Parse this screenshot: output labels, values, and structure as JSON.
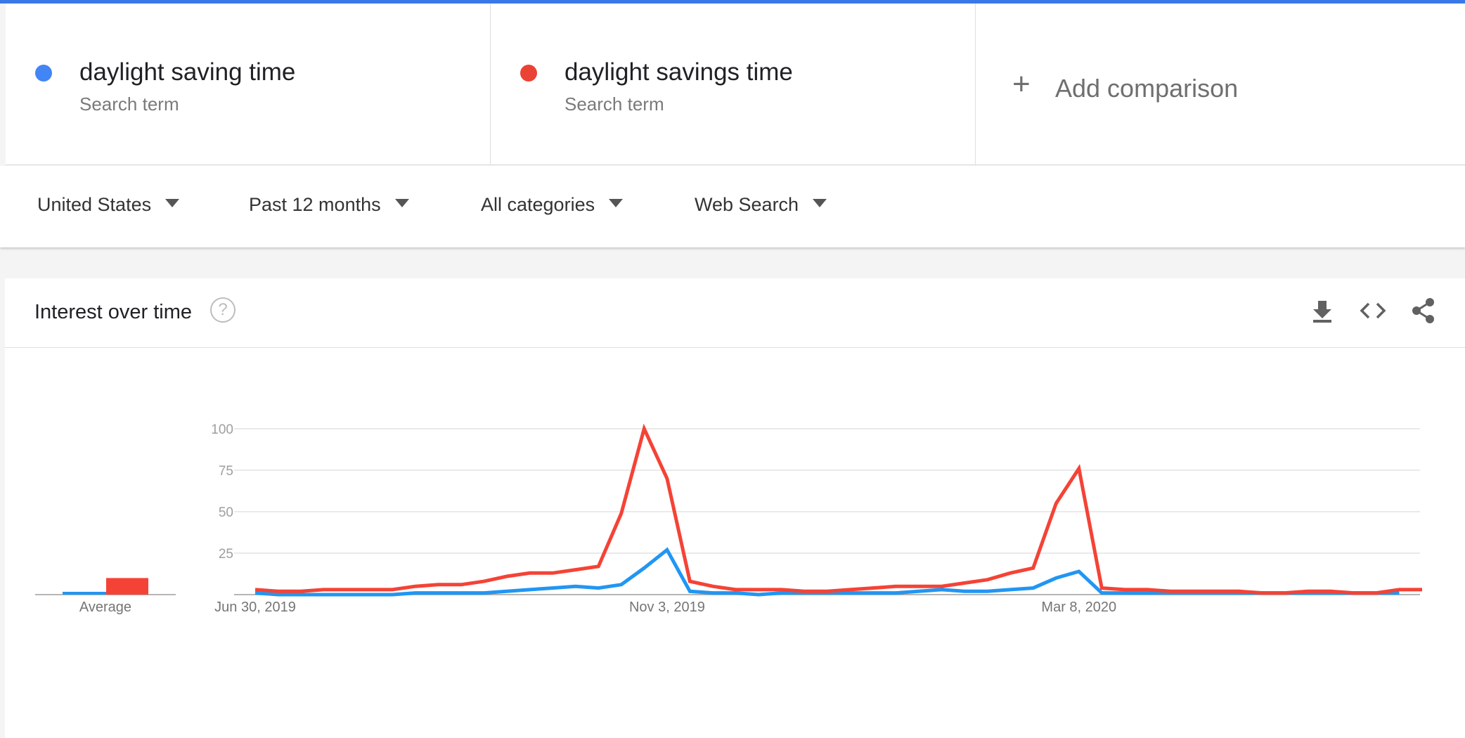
{
  "colors": {
    "top_bar": "#3b78e7",
    "term1": "#4285f4",
    "term2": "#ea4335",
    "line1": "#2196f3",
    "line2": "#f44336"
  },
  "terms": [
    {
      "name": "daylight saving time",
      "type": "Search term",
      "color": "#4285f4"
    },
    {
      "name": "daylight savings time",
      "type": "Search term",
      "color": "#ea4335"
    }
  ],
  "add_comparison": {
    "label": "Add comparison",
    "icon": "plus-icon"
  },
  "filters": [
    {
      "label": "United States",
      "icon": "dropdown-caret-icon"
    },
    {
      "label": "Past 12 months",
      "icon": "dropdown-caret-icon"
    },
    {
      "label": "All categories",
      "icon": "dropdown-caret-icon"
    },
    {
      "label": "Web Search",
      "icon": "dropdown-caret-icon"
    }
  ],
  "card": {
    "title": "Interest over time",
    "help_icon": "question-circle-icon",
    "help_glyph": "?",
    "actions": [
      "download-icon",
      "embed-code-icon",
      "share-icon"
    ]
  },
  "chart_data": {
    "type": "line",
    "x_tick_labels": [
      "Jun 30, 2019",
      "Nov 3, 2019",
      "Mar 8, 2020"
    ],
    "y_ticks": [
      25,
      50,
      75,
      100
    ],
    "ylim": [
      0,
      100
    ],
    "grid": true,
    "series": [
      {
        "name": "daylight saving time",
        "color": "#2196f3",
        "values": [
          1,
          0,
          0,
          0,
          0,
          0,
          0,
          1,
          1,
          1,
          1,
          2,
          3,
          4,
          5,
          4,
          6,
          16,
          27,
          2,
          1,
          1,
          0,
          1,
          1,
          1,
          1,
          1,
          1,
          2,
          3,
          2,
          2,
          3,
          4,
          10,
          14,
          1,
          1,
          1,
          1,
          1,
          1,
          1,
          1,
          1,
          1,
          1,
          1,
          1,
          1
        ]
      },
      {
        "name": "daylight savings time",
        "color": "#f44336",
        "values": [
          3,
          2,
          2,
          3,
          3,
          3,
          3,
          5,
          6,
          6,
          8,
          11,
          13,
          13,
          15,
          17,
          49,
          100,
          70,
          8,
          5,
          3,
          3,
          3,
          2,
          2,
          3,
          4,
          5,
          5,
          5,
          7,
          9,
          13,
          16,
          55,
          76,
          4,
          3,
          3,
          2,
          2,
          2,
          2,
          1,
          1,
          2,
          2,
          1,
          1,
          3,
          3
        ]
      }
    ],
    "average": {
      "label": "Average",
      "values": [
        1,
        10
      ]
    }
  }
}
